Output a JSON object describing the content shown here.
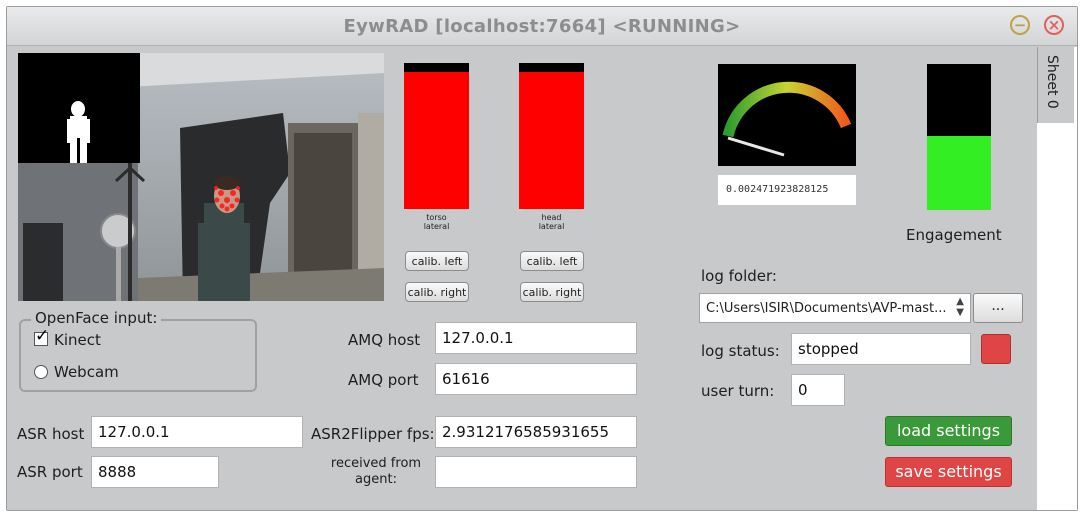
{
  "window": {
    "title": "EywRAD [localhost:7664] <RUNNING>",
    "sheet_tab": "Sheet 0"
  },
  "bars": [
    {
      "label_line1": "torso",
      "label_line2": "lateral",
      "calib_left": "calib. left",
      "calib_right": "calib. right",
      "fill_fraction": 0.94
    },
    {
      "label_line1": "head",
      "label_line2": "lateral",
      "calib_left": "calib. left",
      "calib_right": "calib. right",
      "fill_fraction": 0.94
    }
  ],
  "gauge": {
    "value_text": "0.002471923828125"
  },
  "engagement": {
    "label": "Engagement",
    "fill_fraction": 0.51
  },
  "openface": {
    "legend": "OpenFace input:",
    "options": [
      "Kinect",
      "Webcam"
    ],
    "selected": "Kinect"
  },
  "amq": {
    "host_label": "AMQ host",
    "host_value": "127.0.0.1",
    "port_label": "AMQ port",
    "port_value": "61616"
  },
  "asr": {
    "host_label": "ASR host",
    "host_value": "127.0.0.1",
    "port_label": "ASR port",
    "port_value": "8888"
  },
  "flipper": {
    "fps_label": "ASR2Flipper fps:",
    "fps_value": "2.9312176585931655",
    "received_label_line1": "received from",
    "received_label_line2": "agent:",
    "received_value": ""
  },
  "log": {
    "folder_label": "log folder:",
    "folder_value": "C:\\Users\\ISIR\\Documents\\AVP-mast...",
    "browse_label": "...",
    "status_label": "log status:",
    "status_value": "stopped",
    "status_color": "#e04545"
  },
  "user_turn": {
    "label": "user turn:",
    "value": "0"
  },
  "buttons": {
    "load": "load settings",
    "save": "save settings"
  },
  "colors": {
    "bar_red": "#ff0000",
    "engagement_green": "#33ee22",
    "load_green": "#3a9a3a",
    "save_red": "#e04545"
  }
}
